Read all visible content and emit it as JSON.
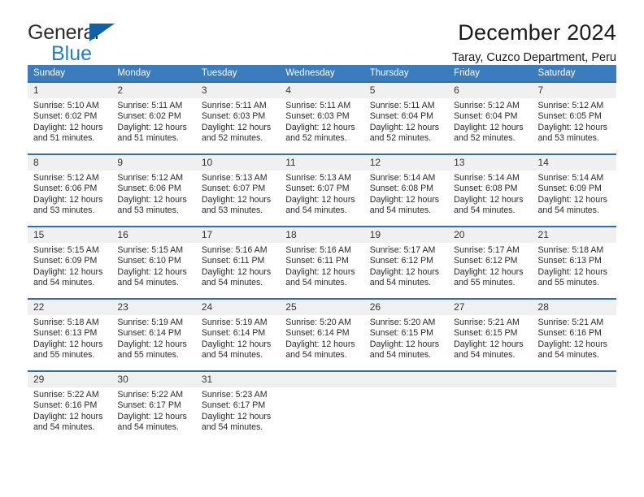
{
  "brand": {
    "name_part1": "General",
    "name_part2": "Blue",
    "triangle_color": "#1161a8",
    "blue_color": "#1f7fc4"
  },
  "header": {
    "title": "December 2024",
    "location": "Taray, Cuzco Department, Peru"
  },
  "theme": {
    "header_bg": "#3a7cbd",
    "row_rule": "#2f6fb0",
    "daynum_bg": "#f0f0f0",
    "text": "#1a1a1a"
  },
  "weekday_headers": [
    "Sunday",
    "Monday",
    "Tuesday",
    "Wednesday",
    "Thursday",
    "Friday",
    "Saturday"
  ],
  "labels": {
    "sunrise_prefix": "Sunrise:",
    "sunset_prefix": "Sunset:",
    "daylight_prefix": "Daylight:"
  },
  "weeks": [
    [
      {
        "day": "1",
        "sunrise": "Sunrise: 5:10 AM",
        "sunset": "Sunset: 6:02 PM",
        "daylight1": "Daylight: 12 hours",
        "daylight2": "and 51 minutes."
      },
      {
        "day": "2",
        "sunrise": "Sunrise: 5:11 AM",
        "sunset": "Sunset: 6:02 PM",
        "daylight1": "Daylight: 12 hours",
        "daylight2": "and 51 minutes."
      },
      {
        "day": "3",
        "sunrise": "Sunrise: 5:11 AM",
        "sunset": "Sunset: 6:03 PM",
        "daylight1": "Daylight: 12 hours",
        "daylight2": "and 52 minutes."
      },
      {
        "day": "4",
        "sunrise": "Sunrise: 5:11 AM",
        "sunset": "Sunset: 6:03 PM",
        "daylight1": "Daylight: 12 hours",
        "daylight2": "and 52 minutes."
      },
      {
        "day": "5",
        "sunrise": "Sunrise: 5:11 AM",
        "sunset": "Sunset: 6:04 PM",
        "daylight1": "Daylight: 12 hours",
        "daylight2": "and 52 minutes."
      },
      {
        "day": "6",
        "sunrise": "Sunrise: 5:12 AM",
        "sunset": "Sunset: 6:04 PM",
        "daylight1": "Daylight: 12 hours",
        "daylight2": "and 52 minutes."
      },
      {
        "day": "7",
        "sunrise": "Sunrise: 5:12 AM",
        "sunset": "Sunset: 6:05 PM",
        "daylight1": "Daylight: 12 hours",
        "daylight2": "and 53 minutes."
      }
    ],
    [
      {
        "day": "8",
        "sunrise": "Sunrise: 5:12 AM",
        "sunset": "Sunset: 6:06 PM",
        "daylight1": "Daylight: 12 hours",
        "daylight2": "and 53 minutes."
      },
      {
        "day": "9",
        "sunrise": "Sunrise: 5:12 AM",
        "sunset": "Sunset: 6:06 PM",
        "daylight1": "Daylight: 12 hours",
        "daylight2": "and 53 minutes."
      },
      {
        "day": "10",
        "sunrise": "Sunrise: 5:13 AM",
        "sunset": "Sunset: 6:07 PM",
        "daylight1": "Daylight: 12 hours",
        "daylight2": "and 53 minutes."
      },
      {
        "day": "11",
        "sunrise": "Sunrise: 5:13 AM",
        "sunset": "Sunset: 6:07 PM",
        "daylight1": "Daylight: 12 hours",
        "daylight2": "and 54 minutes."
      },
      {
        "day": "12",
        "sunrise": "Sunrise: 5:14 AM",
        "sunset": "Sunset: 6:08 PM",
        "daylight1": "Daylight: 12 hours",
        "daylight2": "and 54 minutes."
      },
      {
        "day": "13",
        "sunrise": "Sunrise: 5:14 AM",
        "sunset": "Sunset: 6:08 PM",
        "daylight1": "Daylight: 12 hours",
        "daylight2": "and 54 minutes."
      },
      {
        "day": "14",
        "sunrise": "Sunrise: 5:14 AM",
        "sunset": "Sunset: 6:09 PM",
        "daylight1": "Daylight: 12 hours",
        "daylight2": "and 54 minutes."
      }
    ],
    [
      {
        "day": "15",
        "sunrise": "Sunrise: 5:15 AM",
        "sunset": "Sunset: 6:09 PM",
        "daylight1": "Daylight: 12 hours",
        "daylight2": "and 54 minutes."
      },
      {
        "day": "16",
        "sunrise": "Sunrise: 5:15 AM",
        "sunset": "Sunset: 6:10 PM",
        "daylight1": "Daylight: 12 hours",
        "daylight2": "and 54 minutes."
      },
      {
        "day": "17",
        "sunrise": "Sunrise: 5:16 AM",
        "sunset": "Sunset: 6:11 PM",
        "daylight1": "Daylight: 12 hours",
        "daylight2": "and 54 minutes."
      },
      {
        "day": "18",
        "sunrise": "Sunrise: 5:16 AM",
        "sunset": "Sunset: 6:11 PM",
        "daylight1": "Daylight: 12 hours",
        "daylight2": "and 54 minutes."
      },
      {
        "day": "19",
        "sunrise": "Sunrise: 5:17 AM",
        "sunset": "Sunset: 6:12 PM",
        "daylight1": "Daylight: 12 hours",
        "daylight2": "and 54 minutes."
      },
      {
        "day": "20",
        "sunrise": "Sunrise: 5:17 AM",
        "sunset": "Sunset: 6:12 PM",
        "daylight1": "Daylight: 12 hours",
        "daylight2": "and 55 minutes."
      },
      {
        "day": "21",
        "sunrise": "Sunrise: 5:18 AM",
        "sunset": "Sunset: 6:13 PM",
        "daylight1": "Daylight: 12 hours",
        "daylight2": "and 55 minutes."
      }
    ],
    [
      {
        "day": "22",
        "sunrise": "Sunrise: 5:18 AM",
        "sunset": "Sunset: 6:13 PM",
        "daylight1": "Daylight: 12 hours",
        "daylight2": "and 55 minutes."
      },
      {
        "day": "23",
        "sunrise": "Sunrise: 5:19 AM",
        "sunset": "Sunset: 6:14 PM",
        "daylight1": "Daylight: 12 hours",
        "daylight2": "and 55 minutes."
      },
      {
        "day": "24",
        "sunrise": "Sunrise: 5:19 AM",
        "sunset": "Sunset: 6:14 PM",
        "daylight1": "Daylight: 12 hours",
        "daylight2": "and 54 minutes."
      },
      {
        "day": "25",
        "sunrise": "Sunrise: 5:20 AM",
        "sunset": "Sunset: 6:14 PM",
        "daylight1": "Daylight: 12 hours",
        "daylight2": "and 54 minutes."
      },
      {
        "day": "26",
        "sunrise": "Sunrise: 5:20 AM",
        "sunset": "Sunset: 6:15 PM",
        "daylight1": "Daylight: 12 hours",
        "daylight2": "and 54 minutes."
      },
      {
        "day": "27",
        "sunrise": "Sunrise: 5:21 AM",
        "sunset": "Sunset: 6:15 PM",
        "daylight1": "Daylight: 12 hours",
        "daylight2": "and 54 minutes."
      },
      {
        "day": "28",
        "sunrise": "Sunrise: 5:21 AM",
        "sunset": "Sunset: 6:16 PM",
        "daylight1": "Daylight: 12 hours",
        "daylight2": "and 54 minutes."
      }
    ],
    [
      {
        "day": "29",
        "sunrise": "Sunrise: 5:22 AM",
        "sunset": "Sunset: 6:16 PM",
        "daylight1": "Daylight: 12 hours",
        "daylight2": "and 54 minutes."
      },
      {
        "day": "30",
        "sunrise": "Sunrise: 5:22 AM",
        "sunset": "Sunset: 6:17 PM",
        "daylight1": "Daylight: 12 hours",
        "daylight2": "and 54 minutes."
      },
      {
        "day": "31",
        "sunrise": "Sunrise: 5:23 AM",
        "sunset": "Sunset: 6:17 PM",
        "daylight1": "Daylight: 12 hours",
        "daylight2": "and 54 minutes."
      },
      {
        "day": "",
        "sunrise": "",
        "sunset": "",
        "daylight1": "",
        "daylight2": ""
      },
      {
        "day": "",
        "sunrise": "",
        "sunset": "",
        "daylight1": "",
        "daylight2": ""
      },
      {
        "day": "",
        "sunrise": "",
        "sunset": "",
        "daylight1": "",
        "daylight2": ""
      },
      {
        "day": "",
        "sunrise": "",
        "sunset": "",
        "daylight1": "",
        "daylight2": ""
      }
    ]
  ]
}
